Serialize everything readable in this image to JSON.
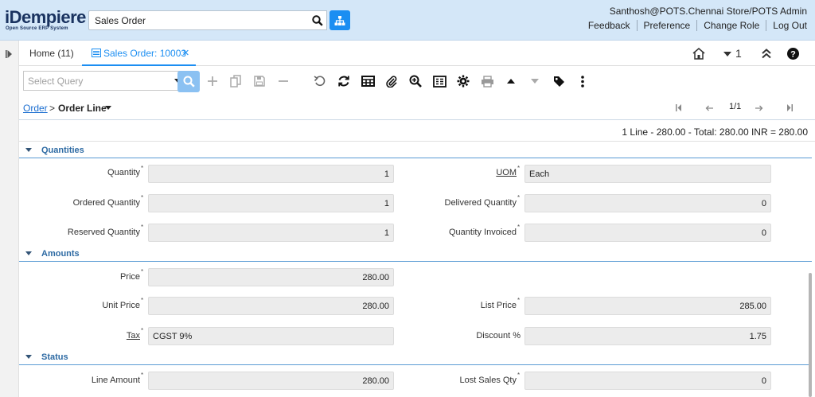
{
  "app": {
    "logo_main": "iDempiere",
    "logo_sub": "Open Source ERP System",
    "search_value": "Sales Order",
    "user": "Santhosh@POTS.Chennai Store/POTS Admin",
    "links": [
      "Feedback",
      "Preference",
      "Change Role",
      "Log Out"
    ]
  },
  "tabs": {
    "home": "Home (11)",
    "active": "Sales Order: 10003",
    "close": "×",
    "win_count": "1"
  },
  "toolbar": {
    "query_placeholder": "Select Query",
    "icons": [
      "search-icon",
      "new-record-icon",
      "copy-icon",
      "save-icon",
      "delete-icon",
      "undo-icon",
      "refresh-icon",
      "grid-toggle-icon",
      "attachment-icon",
      "zoom-icon",
      "report-icon",
      "process-icon",
      "print-icon",
      "previous-record-icon",
      "next-record-icon",
      "tag-icon",
      "more-icon"
    ]
  },
  "breadcrumb": {
    "parent": "Order",
    "sep": ">",
    "current": "Order Line",
    "page": "1/1"
  },
  "summary": "1 Line - 280.00 - Total: 280.00 INR = 280.00",
  "sections": {
    "quantities": "Quantities",
    "amounts": "Amounts",
    "status": "Status"
  },
  "fields": {
    "quantity": {
      "label": "Quantity",
      "value": "1"
    },
    "uom": {
      "label": "UOM",
      "value": "Each"
    },
    "ordered_qty": {
      "label": "Ordered Quantity",
      "value": "1"
    },
    "delivered_qty": {
      "label": "Delivered Quantity",
      "value": "0"
    },
    "reserved_qty": {
      "label": "Reserved Quantity",
      "value": "1"
    },
    "qty_invoiced": {
      "label": "Quantity Invoiced",
      "value": "0"
    },
    "price": {
      "label": "Price",
      "value": "280.00"
    },
    "unit_price": {
      "label": "Unit Price",
      "value": "280.00"
    },
    "list_price": {
      "label": "List Price",
      "value": "285.00"
    },
    "tax": {
      "label": "Tax",
      "value": "CGST 9%"
    },
    "discount": {
      "label": "Discount %",
      "value": "1.75"
    },
    "line_amount": {
      "label": "Line Amount",
      "value": "280.00"
    },
    "lost_sales_qty": {
      "label": "Lost Sales Qty",
      "value": "0"
    }
  },
  "colors": {
    "accent": "#1b8ef2",
    "header_bg": "#d4e7f8",
    "section_title": "#2d6aa3"
  }
}
